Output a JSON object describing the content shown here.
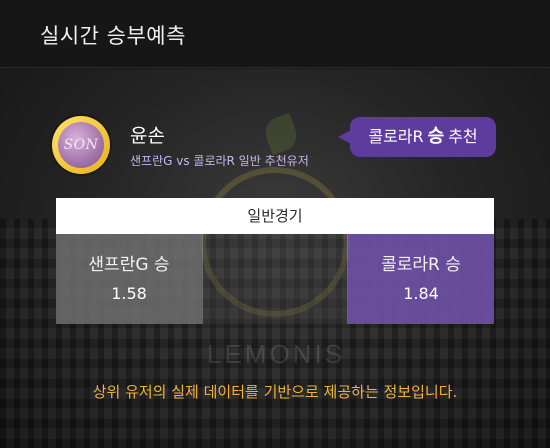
{
  "header": {
    "title": "실시간 승부예측"
  },
  "user": {
    "avatar_text": "SON",
    "name": "윤손",
    "subtitle": "샌프란G vs 콜로라R 일반 추천유저"
  },
  "recommendation": {
    "team": "콜로라R",
    "result": "승",
    "suffix": "추천"
  },
  "game": {
    "title": "일반경기",
    "left": {
      "label": "샌프란G 승",
      "odds": "1.58"
    },
    "right": {
      "label": "콜로라R 승",
      "odds": "1.84"
    }
  },
  "watermark": {
    "text": "LEMONIS"
  },
  "footer": {
    "note": "상위 유저의 실제 데이터를 기반으로 제공하는 정보입니다."
  },
  "colors": {
    "accent_purple": "#5e3c9e",
    "note_orange": "#f0b23c",
    "gold": "#e8b21b"
  }
}
